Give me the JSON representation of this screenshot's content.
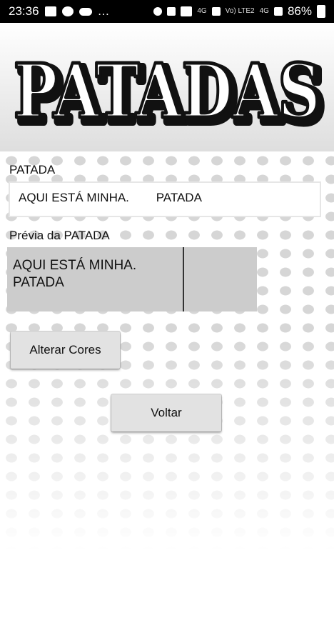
{
  "status_bar": {
    "time": "23:36",
    "more": "…",
    "net1": "4G",
    "volte": "Vo) LTE2",
    "net2": "4G",
    "battery": "86%"
  },
  "header": {
    "logo_text": "PATADAS"
  },
  "patada": {
    "label": "PATADA",
    "input_value": "AQUI ESTÁ MINHA.        PATADA"
  },
  "preview": {
    "label": "Prévia da PATADA",
    "line1": "AQUI ESTÁ MINHA.",
    "line2": "PATADA"
  },
  "buttons": {
    "change_colors": "Alterar Cores",
    "back": "Voltar"
  }
}
